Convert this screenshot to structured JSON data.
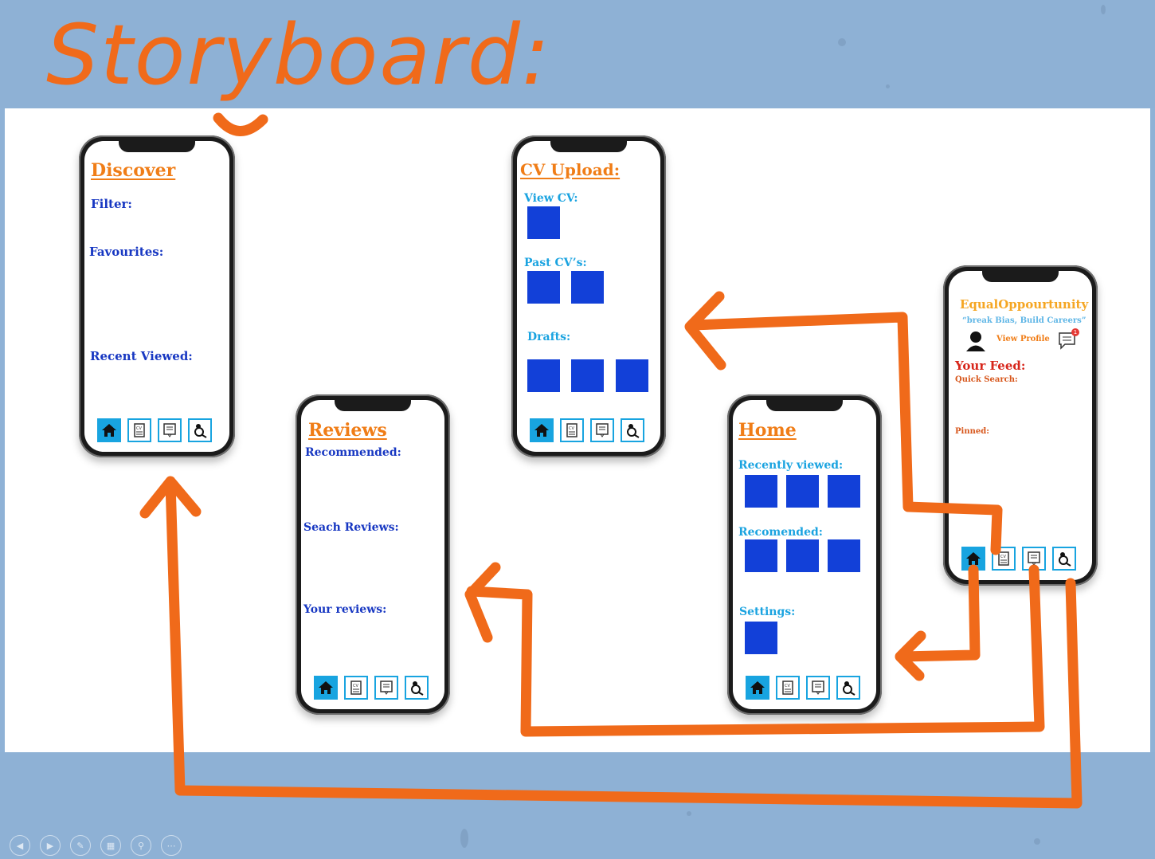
{
  "slide": {
    "title": "Storyboard:"
  },
  "nav_icons": [
    "home-icon",
    "cv-icon",
    "reviews-icon",
    "search-person-icon"
  ],
  "phones": {
    "discover": {
      "title": "Discover",
      "labels": [
        "Filter:",
        "Favourites:",
        "Recent Viewed:"
      ]
    },
    "cv_upload": {
      "title": "CV Upload:",
      "labels": [
        "View CV:",
        "Past CV’s:",
        "Drafts:"
      ]
    },
    "reviews": {
      "title": "Reviews",
      "labels": [
        "Recommended:",
        "Seach Reviews:",
        "Your reviews:"
      ]
    },
    "home": {
      "title": "Home",
      "labels": [
        "Recently viewed:",
        "Recomended:",
        "Settings:"
      ]
    },
    "landing": {
      "app_name": "EqualOppourtunity",
      "tagline": "“break Bias, Build Careers”",
      "view_profile": "View Profile",
      "notification_count": "1",
      "feed_title": "Your Feed:",
      "quick_search": "Quick Search:",
      "pinned": "Pinned:"
    }
  },
  "colors": {
    "accent_orange": "#f06a1a",
    "tile_blue": "#1240d8",
    "nav_blue": "#18a4e0",
    "background": "#8eb1d5"
  },
  "presentation_controls": [
    "previous-icon",
    "next-icon",
    "pen-icon",
    "slides-icon",
    "zoom-icon",
    "more-icon"
  ]
}
